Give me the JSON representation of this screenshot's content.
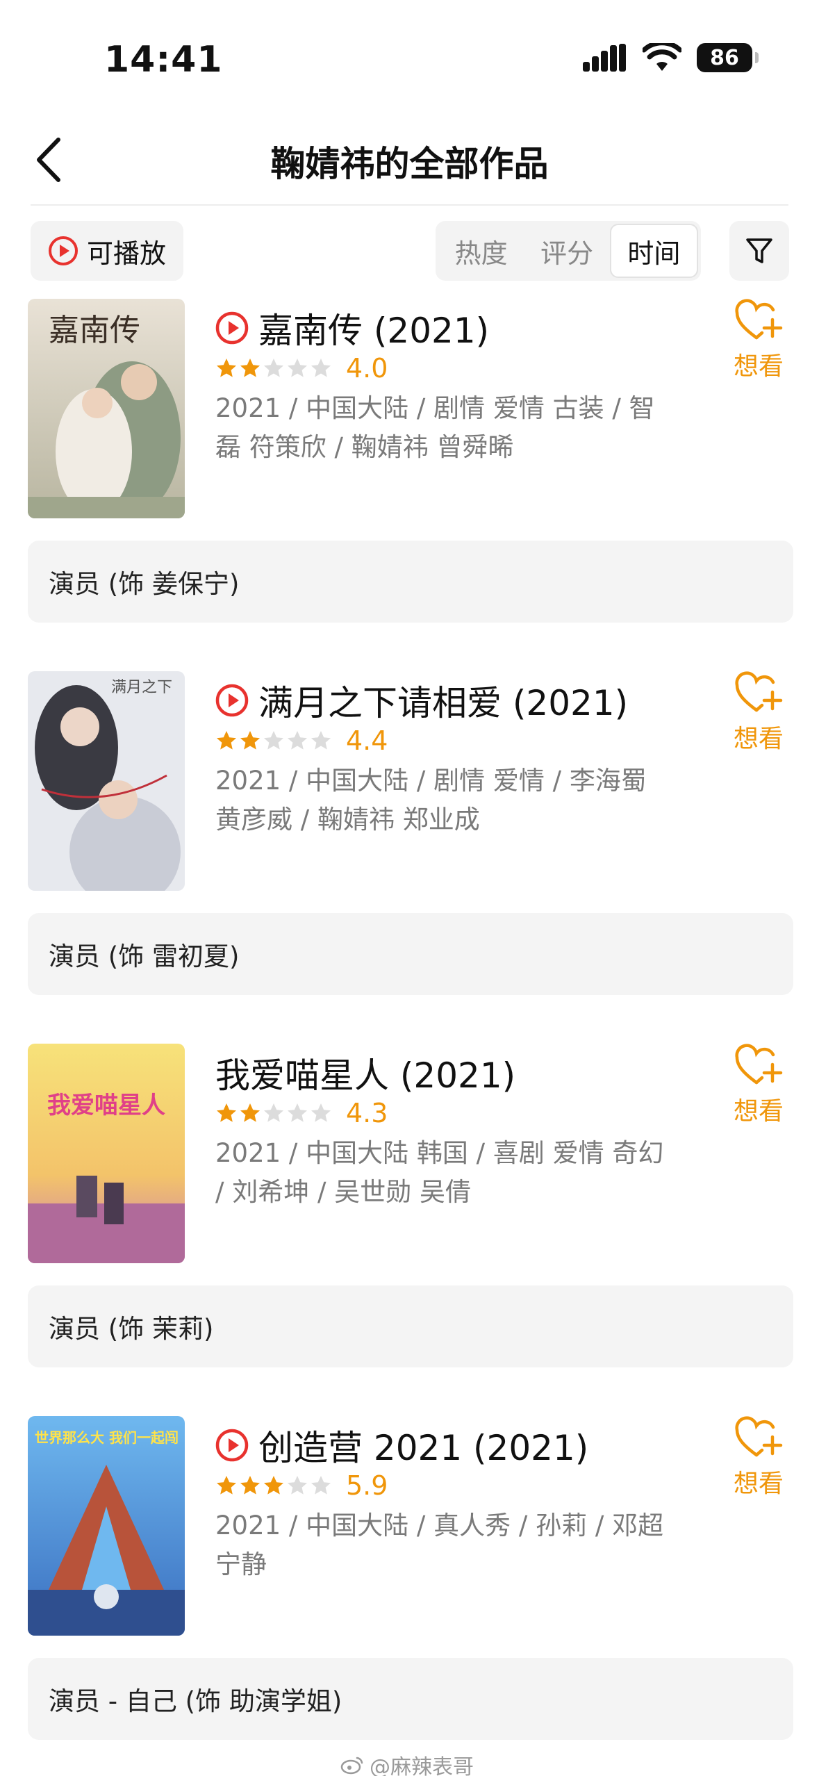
{
  "status_bar": {
    "time": "14:41",
    "battery": "86"
  },
  "nav": {
    "title": "鞠婧祎的全部作品"
  },
  "filters": {
    "playable_label": "可播放",
    "sort_tabs": [
      {
        "label": "热度",
        "active": false
      },
      {
        "label": "评分",
        "active": false
      },
      {
        "label": "时间",
        "active": true
      }
    ]
  },
  "works": [
    {
      "title": "嘉南传 (2021)",
      "playable": true,
      "stars": 2,
      "rating": "4.0",
      "meta": "2021 / 中国大陆 / 剧情 爱情 古装 / 智磊 符策欣 / 鞠婧祎 曾舜晞",
      "poster_text": "嘉南传",
      "wish_label": "想看",
      "role": "演员 (饰 姜保宁)"
    },
    {
      "title": "满月之下请相爱 (2021)",
      "playable": true,
      "stars": 2,
      "rating": "4.4",
      "meta": "2021 / 中国大陆 / 剧情 爱情 / 李海蜀 黄彦威 / 鞠婧祎 郑业成",
      "poster_text": "满月之下",
      "wish_label": "想看",
      "role": "演员 (饰 雷初夏)"
    },
    {
      "title": "我爱喵星人 (2021)",
      "playable": false,
      "stars": 2,
      "rating": "4.3",
      "meta": "2021 / 中国大陆 韩国 / 喜剧 爱情 奇幻 / 刘希坤 / 吴世勋 吴倩",
      "poster_text": "我爱喵星人",
      "wish_label": "想看",
      "role": "演员 (饰 茉莉)"
    },
    {
      "title": "创造营 2021 (2021)",
      "playable": true,
      "stars": 3,
      "rating": "5.9",
      "meta": "2021 / 中国大陆 / 真人秀 / 孙莉 / 邓超 宁静",
      "poster_text": "世界那么大 我们一起闯",
      "wish_label": "想看",
      "role": "演员 - 自己 (饰 助演学姐)"
    }
  ],
  "watermark": "@麻辣表哥",
  "colors": {
    "accent": "#f0960a",
    "play_red": "#e8322e"
  }
}
